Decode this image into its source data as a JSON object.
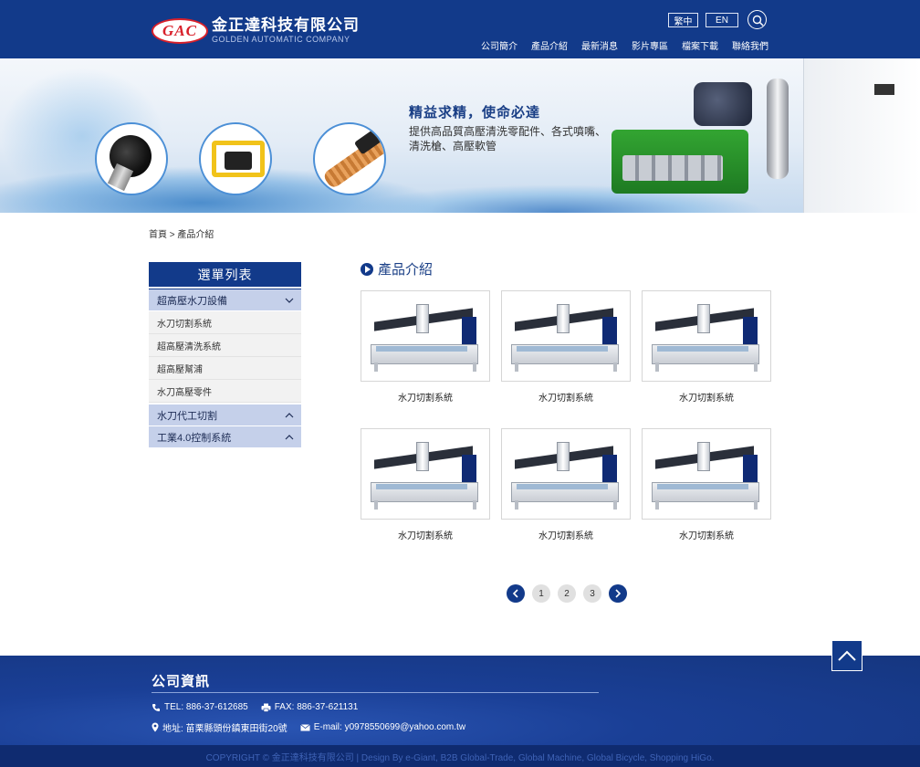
{
  "header": {
    "logo_mark": "GAC",
    "company_cn": "金正達科技有限公司",
    "company_en": "GOLDEN AUTOMATIC COMPANY",
    "lang_zh": "繁中",
    "lang_en": "EN",
    "nav": [
      "公司簡介",
      "產品介紹",
      "最新消息",
      "影片專區",
      "檔案下載",
      "聯絡我們"
    ]
  },
  "banner": {
    "title": "精益求精，使命必達",
    "line1": "提供高品質高壓清洗零配件、各式噴嘴、",
    "line2": "清洗槍、高壓軟管"
  },
  "breadcrumb": "首頁 > 產品介紹",
  "sidebar": {
    "heading": "選單列表",
    "categories": [
      {
        "label": "超高壓水刀設備",
        "expanded": true,
        "items": [
          "水刀切割系統",
          "超高壓清洗系統",
          "超高壓幫浦",
          "水刀高壓零件"
        ]
      },
      {
        "label": "水刀代工切割",
        "expanded": false
      },
      {
        "label": "工業4.0控制系統",
        "expanded": false
      }
    ]
  },
  "main": {
    "title": "產品介紹",
    "products": [
      {
        "name": "水刀切割系統"
      },
      {
        "name": "水刀切割系統"
      },
      {
        "name": "水刀切割系統"
      },
      {
        "name": "水刀切割系統"
      },
      {
        "name": "水刀切割系統"
      },
      {
        "name": "水刀切割系統"
      }
    ]
  },
  "pagination": {
    "pages": [
      "1",
      "2",
      "3"
    ]
  },
  "footer": {
    "title": "公司資訊",
    "tel": "TEL: 886-37-612685",
    "fax": "FAX: 886-37-621131",
    "address": "地址: 苗栗縣頭份鎮東田街20號",
    "email": "E-mail: y0978550699@yahoo.com.tw",
    "copyright": "COPYRIGHT © 金正達科技有限公司 | Design By  e-Giant, B2B Global-Trade, Global Machine, Global Bicycle, Shopping HiGo."
  },
  "colors": {
    "primary": "#123a8a",
    "sidebar_category_bg": "#c5d0ea",
    "logo_red": "#d8202a"
  }
}
